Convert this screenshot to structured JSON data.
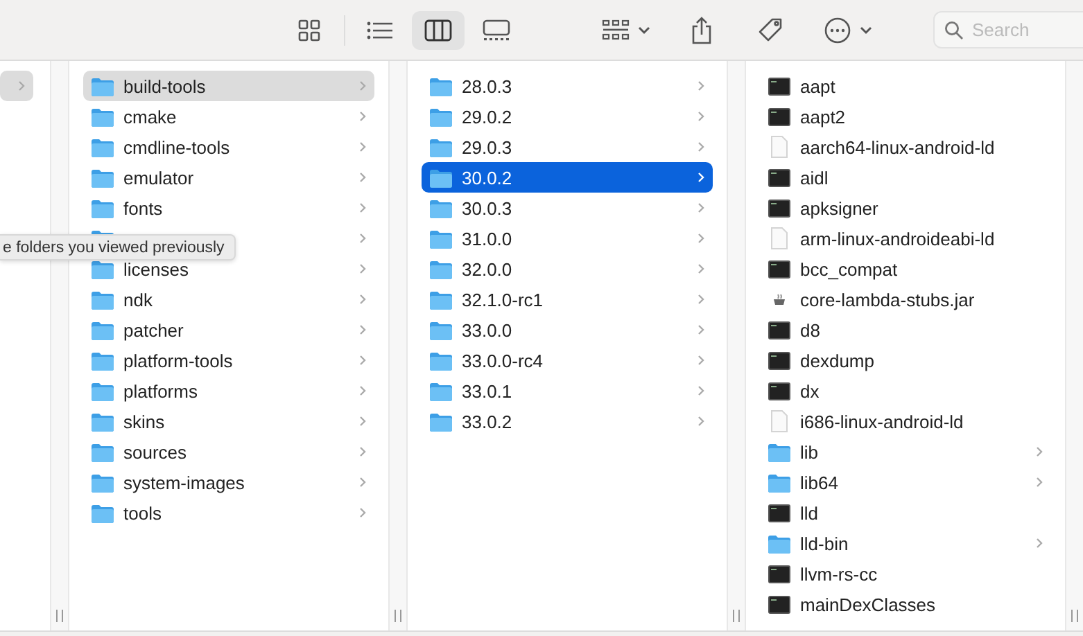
{
  "toolbar": {
    "views": [
      {
        "kind": "icons",
        "selected": false
      },
      {
        "kind": "list",
        "selected": false
      },
      {
        "kind": "columns",
        "selected": true
      },
      {
        "kind": "gallery",
        "selected": false
      }
    ],
    "search": {
      "placeholder": "Search"
    }
  },
  "columns": [
    {
      "items": [
        {
          "selected": true,
          "chevron": true
        }
      ]
    },
    {
      "items": [
        {
          "kind": "folder",
          "name": "build-tools",
          "selected": true,
          "chevron": true
        },
        {
          "kind": "folder",
          "name": "cmake",
          "selected": false,
          "chevron": true
        },
        {
          "kind": "folder",
          "name": "cmdline-tools",
          "selected": false,
          "chevron": true
        },
        {
          "kind": "folder",
          "name": "emulator",
          "selected": false,
          "chevron": true
        },
        {
          "kind": "folder",
          "name": "fonts",
          "selected": false,
          "chevron": true
        },
        {
          "kind": "folder",
          "selected": false,
          "chevron": true
        },
        {
          "kind": "folder",
          "name": "licenses",
          "selected": false,
          "chevron": true
        },
        {
          "kind": "folder",
          "name": "ndk",
          "selected": false,
          "chevron": true
        },
        {
          "kind": "folder",
          "name": "patcher",
          "selected": false,
          "chevron": true
        },
        {
          "kind": "folder",
          "name": "platform-tools",
          "selected": false,
          "chevron": true
        },
        {
          "kind": "folder",
          "name": "platforms",
          "selected": false,
          "chevron": true
        },
        {
          "kind": "folder",
          "name": "skins",
          "selected": false,
          "chevron": true
        },
        {
          "kind": "folder",
          "name": "sources",
          "selected": false,
          "chevron": true
        },
        {
          "kind": "folder",
          "name": "system-images",
          "selected": false,
          "chevron": true
        },
        {
          "kind": "folder",
          "name": "tools",
          "selected": false,
          "chevron": true
        }
      ]
    },
    {
      "items": [
        {
          "kind": "folder",
          "name": "28.0.3",
          "selected": false,
          "chevron": true
        },
        {
          "kind": "folder",
          "name": "29.0.2",
          "selected": false,
          "chevron": true
        },
        {
          "kind": "folder",
          "name": "29.0.3",
          "selected": false,
          "chevron": true
        },
        {
          "kind": "folder",
          "name": "30.0.2",
          "selected": true,
          "chevron": true
        },
        {
          "kind": "folder",
          "name": "30.0.3",
          "selected": false,
          "chevron": true
        },
        {
          "kind": "folder",
          "name": "31.0.0",
          "selected": false,
          "chevron": true
        },
        {
          "kind": "folder",
          "name": "32.0.0",
          "selected": false,
          "chevron": true
        },
        {
          "kind": "folder",
          "name": "32.1.0-rc1",
          "selected": false,
          "chevron": true
        },
        {
          "kind": "folder",
          "name": "33.0.0",
          "selected": false,
          "chevron": true
        },
        {
          "kind": "folder",
          "name": "33.0.0-rc4",
          "selected": false,
          "chevron": true
        },
        {
          "kind": "folder",
          "name": "33.0.1",
          "selected": false,
          "chevron": true
        },
        {
          "kind": "folder",
          "name": "33.0.2",
          "selected": false,
          "chevron": true
        }
      ]
    },
    {
      "items": [
        {
          "kind": "exec",
          "name": "aapt",
          "selected": false,
          "chevron": false
        },
        {
          "kind": "exec",
          "name": "aapt2",
          "selected": false,
          "chevron": false
        },
        {
          "kind": "document",
          "name": "aarch64-linux-android-ld",
          "selected": false,
          "chevron": false
        },
        {
          "kind": "exec",
          "name": "aidl",
          "selected": false,
          "chevron": false
        },
        {
          "kind": "exec",
          "name": "apksigner",
          "selected": false,
          "chevron": false
        },
        {
          "kind": "document",
          "name": "arm-linux-androideabi-ld",
          "selected": false,
          "chevron": false
        },
        {
          "kind": "exec",
          "name": "bcc_compat",
          "selected": false,
          "chevron": false
        },
        {
          "kind": "jar",
          "name": "core-lambda-stubs.jar",
          "selected": false,
          "chevron": false
        },
        {
          "kind": "exec",
          "name": "d8",
          "selected": false,
          "chevron": false
        },
        {
          "kind": "exec",
          "name": "dexdump",
          "selected": false,
          "chevron": false
        },
        {
          "kind": "exec",
          "name": "dx",
          "selected": false,
          "chevron": false
        },
        {
          "kind": "document",
          "name": "i686-linux-android-ld",
          "selected": false,
          "chevron": false
        },
        {
          "kind": "folder",
          "name": "lib",
          "selected": false,
          "chevron": true
        },
        {
          "kind": "folder",
          "name": "lib64",
          "selected": false,
          "chevron": true
        },
        {
          "kind": "exec",
          "name": "lld",
          "selected": false,
          "chevron": false
        },
        {
          "kind": "folder",
          "name": "lld-bin",
          "selected": false,
          "chevron": true
        },
        {
          "kind": "exec",
          "name": "llvm-rs-cc",
          "selected": false,
          "chevron": false
        },
        {
          "kind": "exec",
          "name": "mainDexClasses",
          "selected": false,
          "chevron": false
        }
      ]
    }
  ],
  "tooltip": {
    "text": "e folders you viewed previously"
  }
}
